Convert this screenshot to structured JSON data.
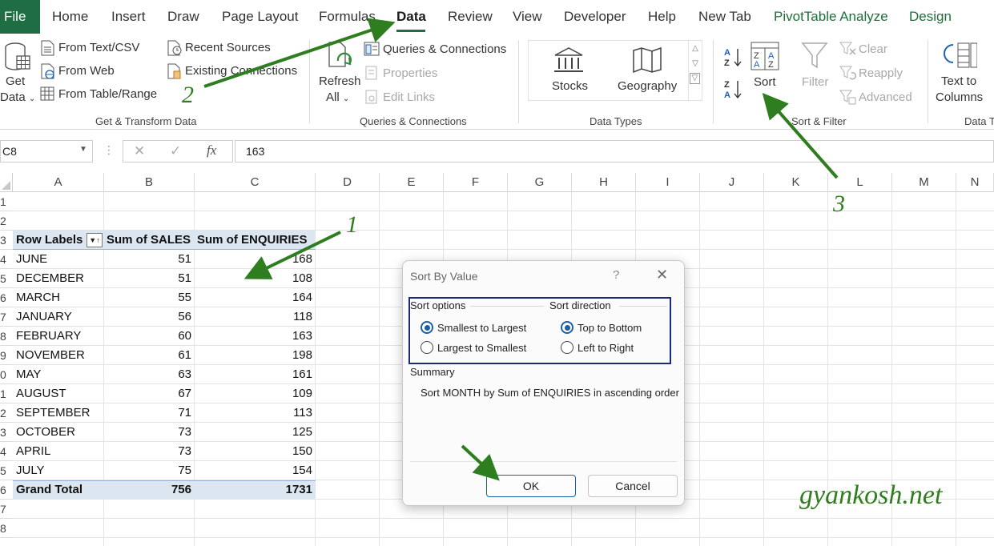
{
  "tabs": [
    "File",
    "Home",
    "Insert",
    "Draw",
    "Page Layout",
    "Formulas",
    "Data",
    "Review",
    "View",
    "Developer",
    "Help",
    "New Tab",
    "PivotTable Analyze",
    "Design"
  ],
  "ribbon": {
    "get_data": [
      "Get",
      "Data"
    ],
    "get_transform": [
      "From Text/CSV",
      "From Web",
      "From Table/Range",
      "Recent Sources",
      "Existing Connections"
    ],
    "group_get_transform": "Get & Transform Data",
    "refresh": [
      "Refresh",
      "All"
    ],
    "queries": [
      "Queries & Connections",
      "Properties",
      "Edit Links"
    ],
    "group_queries": "Queries & Connections",
    "datatypes": [
      "Stocks",
      "Geography"
    ],
    "group_datatypes": "Data Types",
    "sort_label": "Sort",
    "filter_label": "Filter",
    "filter_side": [
      "Clear",
      "Reapply",
      "Advanced"
    ],
    "group_sort": "Sort & Filter",
    "text_to_columns": [
      "Text to",
      "Columns"
    ],
    "group_datatools": "Data T"
  },
  "formula_bar": {
    "name_box": "C8",
    "value": "163"
  },
  "columns": [
    "A",
    "B",
    "C",
    "D",
    "E",
    "F",
    "G",
    "H",
    "I",
    "J",
    "K",
    "L",
    "M",
    "N"
  ],
  "row_numbers": [
    "1",
    "2",
    "3",
    "4",
    "5",
    "6",
    "7",
    "8",
    "9",
    "0",
    "1",
    "2",
    "3",
    "4",
    "5",
    "6",
    "7",
    "8"
  ],
  "pivot": {
    "headers": [
      "Row Labels",
      "Sum of SALES",
      "Sum of ENQUIRIES"
    ],
    "rows": [
      [
        "JUNE",
        "51",
        "168"
      ],
      [
        "DECEMBER",
        "51",
        "108"
      ],
      [
        "MARCH",
        "55",
        "164"
      ],
      [
        "JANUARY",
        "56",
        "118"
      ],
      [
        "FEBRUARY",
        "60",
        "163"
      ],
      [
        "NOVEMBER",
        "61",
        "198"
      ],
      [
        "MAY",
        "63",
        "161"
      ],
      [
        "AUGUST",
        "67",
        "109"
      ],
      [
        "SEPTEMBER",
        "71",
        "113"
      ],
      [
        "OCTOBER",
        "73",
        "125"
      ],
      [
        "APRIL",
        "73",
        "150"
      ],
      [
        "JULY",
        "75",
        "154"
      ]
    ],
    "total": [
      "Grand Total",
      "756",
      "1731"
    ]
  },
  "dialog": {
    "title": "Sort By Value",
    "help": "?",
    "sort_options_label": "Sort options",
    "opt_small": "Smallest to Largest",
    "opt_large": "Largest to Smallest",
    "sort_direction_label": "Sort direction",
    "dir_tb": "Top to Bottom",
    "dir_lr": "Left to Right",
    "summary_label": "Summary",
    "summary_text": "Sort MONTH by Sum of ENQUIRIES in ascending order",
    "ok": "OK",
    "cancel": "Cancel"
  },
  "annotations": {
    "n1": "1",
    "n2": "2",
    "n3": "3",
    "watermark": "gyankosh.net"
  },
  "colors": {
    "accent": "#1f6e43",
    "arrow": "#2e7d1f",
    "pivot_header": "#dce6f1",
    "dialog_focus": "#1b2a7a"
  }
}
